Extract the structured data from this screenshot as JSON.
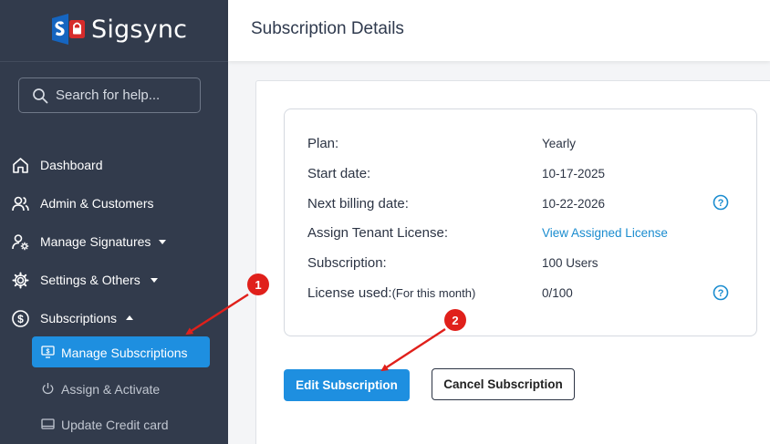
{
  "app": {
    "brand": "Sigsync"
  },
  "search": {
    "placeholder": "Search for help..."
  },
  "nav": {
    "dashboard": "Dashboard",
    "admin": "Admin & Customers",
    "signatures": "Manage Signatures",
    "settings": "Settings & Others",
    "subscriptions": "Subscriptions",
    "sub_items": {
      "manage": "Manage Subscriptions",
      "assign": "Assign & Activate",
      "credit": "Update Credit card"
    }
  },
  "header": {
    "title": "Subscription Details"
  },
  "details": {
    "plan_label": "Plan:",
    "plan_value": "Yearly",
    "start_label": "Start date:",
    "start_value": "10-17-2025",
    "billing_label": "Next billing date:",
    "billing_value": "10-22-2026",
    "tenant_label": "Assign Tenant License:",
    "tenant_value": "View Assigned License",
    "subscription_label": "Subscription:",
    "subscription_value": "100 Users",
    "license_label": "License used:",
    "license_note": "(For this month)",
    "license_value": "0/100"
  },
  "actions": {
    "edit": "Edit Subscription",
    "cancel": "Cancel Subscription"
  },
  "annotations": {
    "badge1": "1",
    "badge2": "2"
  },
  "colors": {
    "sidebar_bg": "#323b4c",
    "accent": "#1e8fe0",
    "link": "#1a8ccf",
    "annotation": "#e0201b",
    "logo_blue": "#1565c0"
  },
  "icons": [
    "search-icon",
    "home-icon",
    "users-icon",
    "user-gear-icon",
    "gear-icon",
    "dollar-icon",
    "chevron-down-icon",
    "chevron-up-icon",
    "monitor-dollar-icon",
    "power-icon",
    "card-icon",
    "help-icon"
  ]
}
